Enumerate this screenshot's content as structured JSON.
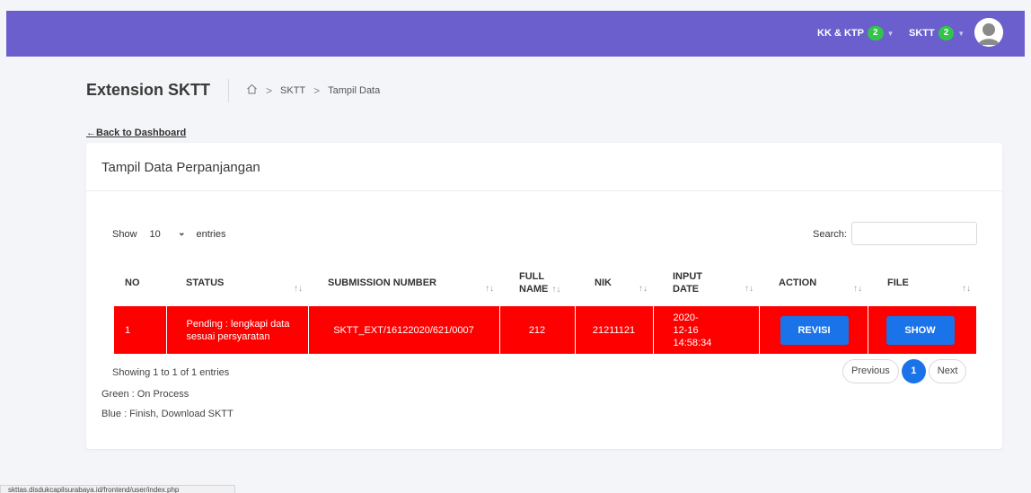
{
  "topbar": {
    "color": "#6a5fcd",
    "items": [
      {
        "label": "KK & KTP",
        "badge": "2"
      },
      {
        "label": "SKTT",
        "badge": "2"
      }
    ],
    "avatar_icon": "user-avatar-icon"
  },
  "header": {
    "title": "Extension SKTT",
    "breadcrumb": {
      "home_icon": "home-icon",
      "items": [
        "SKTT",
        "Tampil Data"
      ],
      "separator": ">"
    }
  },
  "back_link": {
    "arrow": "←",
    "label": "Back to Dashboard"
  },
  "card": {
    "title": "Tampil Data Perpanjangan",
    "show_label": "Show",
    "entries_value": "10",
    "entries_label": "entries",
    "search_label": "Search:",
    "search_value": "",
    "columns": [
      {
        "label": "NO"
      },
      {
        "label": "STATUS"
      },
      {
        "label": "SUBMISSION NUMBER"
      },
      {
        "label": "FULL NAME"
      },
      {
        "label": "NIK"
      },
      {
        "label": "INPUT DATE"
      },
      {
        "label": "ACTION"
      },
      {
        "label": "FILE"
      }
    ],
    "sort_icon": "↑↓",
    "rows": [
      {
        "no": "1",
        "status": "Pending : lengkapi data sesuai persyaratan",
        "submission_number": "SKTT_EXT/16122020/621/0007",
        "full_name": "212",
        "nik": "21211121",
        "input_date": "2020-12-16 14:58:34",
        "action_label": "REVISI",
        "file_label": "SHOW",
        "row_color": "#ff0000"
      }
    ],
    "showing_text": "Showing 1 to 1 of 1 entries",
    "legend": [
      "Green : On Process",
      "Blue : Finish, Download SKTT"
    ],
    "pagination": {
      "previous": "Previous",
      "current": "1",
      "next": "Next"
    }
  },
  "statusbar_text": "skttas.disdukcapilsurabaya.id/frontend/user/index.php",
  "colors": {
    "accent": "#1a73e8",
    "badge": "#33c44a",
    "row_pending": "#ff0000"
  }
}
